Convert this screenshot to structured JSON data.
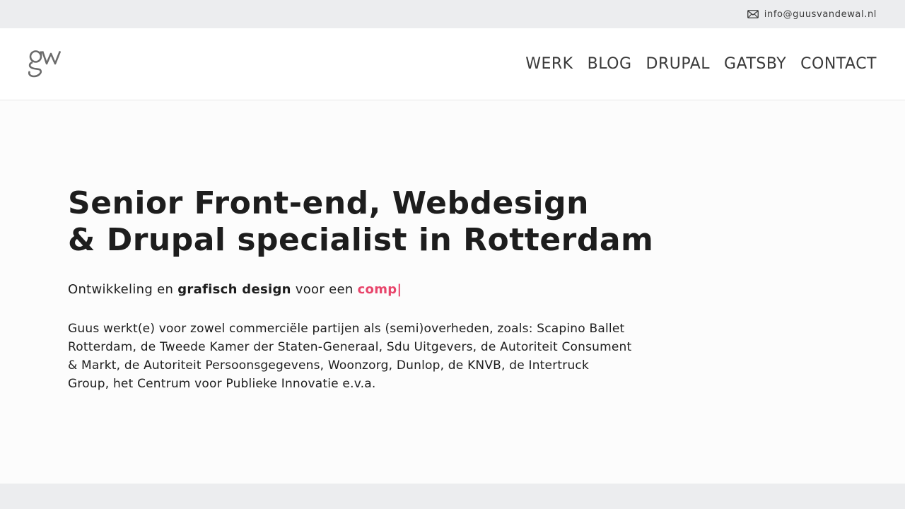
{
  "topbar": {
    "email": "info@guusvandewal.nl",
    "email_icon": "envelope-icon"
  },
  "header": {
    "logo_text": "gw",
    "nav": [
      {
        "label": "WERK"
      },
      {
        "label": "BLOG"
      },
      {
        "label": "DRUPAL"
      },
      {
        "label": "GATSBY"
      },
      {
        "label": "CONTACT"
      }
    ]
  },
  "hero": {
    "title_line1": "Senior Front-end, Webdesign",
    "title_line2": "& Drupal specialist in Rotterdam",
    "tagline_prefix": "Ontwikkeling en ",
    "tagline_bold": "grafisch design",
    "tagline_middle": " voor een ",
    "tagline_typed": "comp|",
    "clients_text": "Guus werkt(e) voor zowel commerciële partijen als (semi)overheden, zoals: Scapino Ballet Rotterdam, de Tweede Kamer der Staten-Generaal, Sdu Uitgevers, de Autoriteit Consument & Markt, de Autoriteit Persoonsgegevens, Woonzorg, Dunlop, de KNVB, de Intertruck Group, het Centrum voor Publieke Innovatie e.v.a."
  },
  "colors": {
    "accent": "#e8456b",
    "text": "#1d1d1d",
    "nav_text": "#3a3a3a",
    "topbar_bg": "#ecedef",
    "hero_bg": "#fcfcfc",
    "logo": "#6b6b6b"
  }
}
